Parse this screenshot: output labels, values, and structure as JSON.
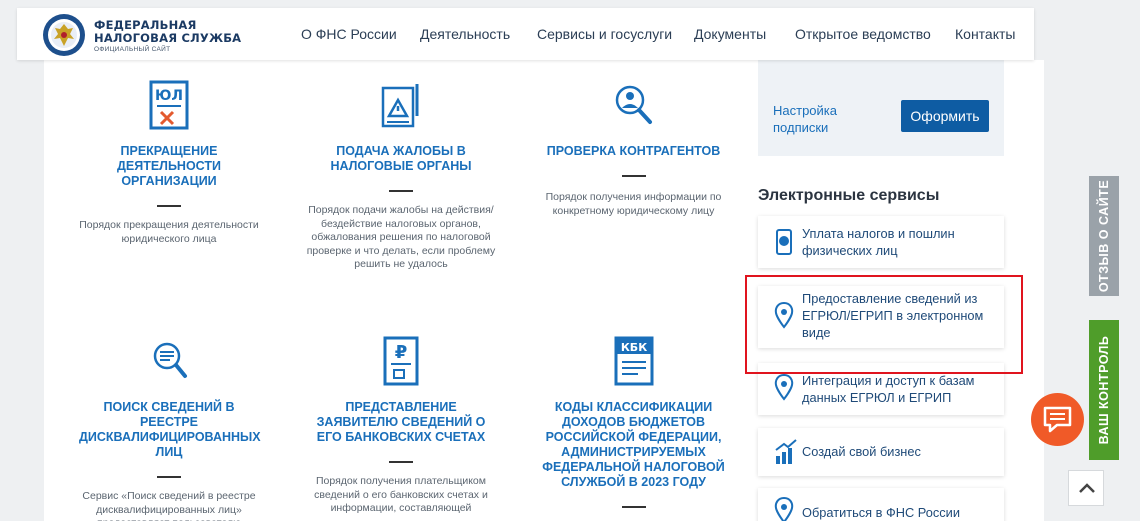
{
  "header": {
    "logo_line1": "ФЕДЕРАЛЬНАЯ",
    "logo_line2": "НАЛОГОВАЯ СЛУЖБА",
    "logo_line3": "ОФИЦИАЛЬНЫЙ САЙТ",
    "nav": [
      "О ФНС России",
      "Деятельность",
      "Сервисы и госуслуги",
      "Документы",
      "Открытое ведомство",
      "Контакты"
    ]
  },
  "cards": [
    {
      "title": "ПРЕКРАЩЕНИЕ ДЕЯТЕЛЬНОСТИ ОРГАНИЗАЦИИ",
      "desc": "Порядок прекращения деятельности юридического лица",
      "icon": "yul-document-icon"
    },
    {
      "title": "ПОДАЧА ЖАЛОБЫ В НАЛОГОВЫЕ ОРГАНЫ",
      "desc": "Порядок подачи жалобы на действия/бездействие налоговых органов, обжалования решения по налоговой проверке и что делать, если проблему решить не удалось",
      "icon": "complaint-document-icon"
    },
    {
      "title": "ПРОВЕРКА КОНТРАГЕНТОВ",
      "desc": "Порядок получения информации по конкретному юридическому лицу",
      "icon": "magnifier-person-icon"
    },
    {
      "title": "ПОИСК СВЕДЕНИЙ В РЕЕСТРЕ ДИСКВАЛИФИЦИРОВАННЫХ ЛИЦ",
      "desc": "Сервис «Поиск сведений в реестре дисквалифицированных лиц» предоставляет пользователю",
      "icon": "search-list-icon"
    },
    {
      "title": "ПРЕДСТАВЛЕНИЕ ЗАЯВИТЕЛЮ СВЕДЕНИЙ О ЕГО БАНКОВСКИХ СЧЕТАХ",
      "desc": "Порядок получения плательщиком сведений о его банковских счетах и информации, составляющей",
      "icon": "ruble-document-icon"
    },
    {
      "title": "КОДЫ КЛАССИФИКАЦИИ ДОХОДОВ БЮДЖЕТОВ РОССИЙСКОЙ ФЕДЕРАЦИИ, АДМИНИСТРИРУЕМЫХ ФЕДЕРАЛЬНОЙ НАЛОГОВОЙ СЛУЖБОЙ В 2023 ГОДУ",
      "desc": "",
      "icon": "kbk-document-icon"
    }
  ],
  "icon_labels": {
    "yul": "ЮЛ",
    "kbk": "КБК",
    "ruble": "₽"
  },
  "subscribe": {
    "label": "Настройка подписки",
    "button": "Оформить"
  },
  "electronic_services": {
    "title": "Электронные сервисы",
    "items": [
      {
        "label": "Уплата налогов и пошлин физических лиц",
        "icon": "phone-ruble-icon"
      },
      {
        "label": "Предоставление сведений из ЕГРЮЛ/ЕГРИП в электронном виде",
        "icon": "location-pin-icon"
      },
      {
        "label": "Интеграция и доступ к базам данных ЕГРЮЛ и ЕГРИП",
        "icon": "location-pin-icon"
      },
      {
        "label": "Создай свой бизнес",
        "icon": "growth-chart-icon"
      },
      {
        "label": "Обратиться в ФНС России",
        "icon": "location-pin-icon"
      }
    ]
  },
  "side_tabs": {
    "feedback": "ОТЗЫВ О САЙТЕ",
    "control": "ВАШ КОНТРОЛЬ"
  },
  "colors": {
    "accent": "#1a6fba",
    "highlight": "#e0141e",
    "feedback_tab": "#9aa2a9",
    "control_tab": "#4f9d2a",
    "chat_button": "#f05a28"
  }
}
